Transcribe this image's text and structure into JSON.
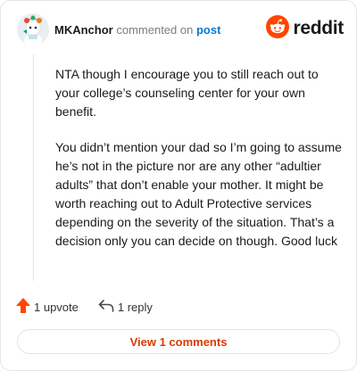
{
  "comment": {
    "author": "MKAnchor",
    "action_text": "commented on",
    "post_link": "post",
    "paragraphs": [
      "NTA though I encourage you to still reach out to your college’s counseling center for your own benefit.",
      "You didn’t mention your dad so I’m going to assume he’s not in the picture nor are any other “adultier adults” that don’t enable your mother. It might be worth reaching out to Adult Protective services depending on the severity of the situation. That’s a decision only you can decide on though. Good luck"
    ],
    "upvotes_label": "1 upvote",
    "replies_label": "1 reply"
  },
  "brand": {
    "name": "reddit",
    "icon": "reddit-logo-icon",
    "color": "#ff4500"
  },
  "footer": {
    "view_comments_label": "View 1 comments"
  },
  "icons": {
    "avatar": "avatar",
    "upvote": "upvote-arrow-icon",
    "reply": "reply-arrow-icon"
  },
  "colors": {
    "accent": "#d93a00",
    "upvote": "#ff4500",
    "link": "#0079d3"
  }
}
